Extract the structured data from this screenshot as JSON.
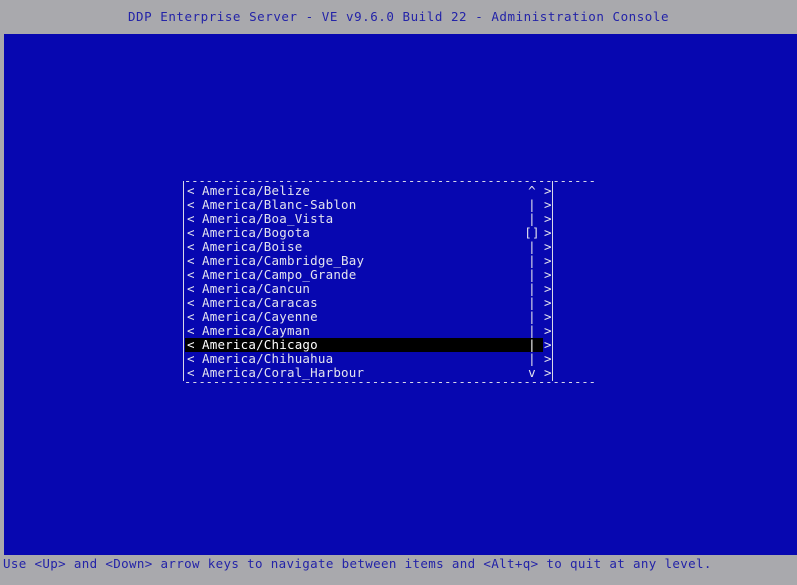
{
  "titlebar": {
    "title": "DDP Enterprise Server - VE v9.6.0 Build 22 - Administration Console"
  },
  "dialog": {
    "top_border": "---------------------------------------------------------",
    "bottom_border": "---------------------------------------------------------",
    "left_marker": "<",
    "right_marker": ">",
    "scrollbar": {
      "up_arrow": "^",
      "down_arrow": "v",
      "track": "|",
      "thumb": "[]",
      "thumb_row_index": 3
    },
    "items": [
      {
        "label": "America/Belize",
        "left": "<",
        "bar": "^",
        "right": ">",
        "selected": false
      },
      {
        "label": "America/Blanc-Sablon",
        "left": "<",
        "bar": "|",
        "right": ">",
        "selected": false
      },
      {
        "label": "America/Boa_Vista",
        "left": "<",
        "bar": "|",
        "right": ">",
        "selected": false
      },
      {
        "label": "America/Bogota",
        "left": "<",
        "bar": "[]",
        "right": ">",
        "selected": false
      },
      {
        "label": "America/Boise",
        "left": "<",
        "bar": "|",
        "right": ">",
        "selected": false
      },
      {
        "label": "America/Cambridge_Bay",
        "left": "<",
        "bar": "|",
        "right": ">",
        "selected": false
      },
      {
        "label": "America/Campo_Grande",
        "left": "<",
        "bar": "|",
        "right": ">",
        "selected": false
      },
      {
        "label": "America/Cancun",
        "left": "<",
        "bar": "|",
        "right": ">",
        "selected": false
      },
      {
        "label": "America/Caracas",
        "left": "<",
        "bar": "|",
        "right": ">",
        "selected": false
      },
      {
        "label": "America/Cayenne",
        "left": "<",
        "bar": "|",
        "right": ">",
        "selected": false
      },
      {
        "label": "America/Cayman",
        "left": "<",
        "bar": "|",
        "right": ">",
        "selected": false
      },
      {
        "label": "America/Chicago",
        "left": "<",
        "bar": "|",
        "right": ">",
        "selected": true
      },
      {
        "label": "America/Chihuahua",
        "left": "<",
        "bar": "|",
        "right": ">",
        "selected": false
      },
      {
        "label": "America/Coral_Harbour",
        "left": "<",
        "bar": "v",
        "right": ">",
        "selected": false
      }
    ]
  },
  "statusbar": {
    "hint": "Use <Up> and <Down> arrow keys to navigate between items and <Alt+q> to quit at any level."
  },
  "colors": {
    "chrome_gray": "#a9a9ad",
    "console_blue": "#0707b0",
    "title_text_blue": "#2323a8",
    "list_text": "#e4e4ef",
    "selection_bg": "#000000",
    "selection_fg": "#ffffff",
    "border": "#d8d8e8"
  }
}
